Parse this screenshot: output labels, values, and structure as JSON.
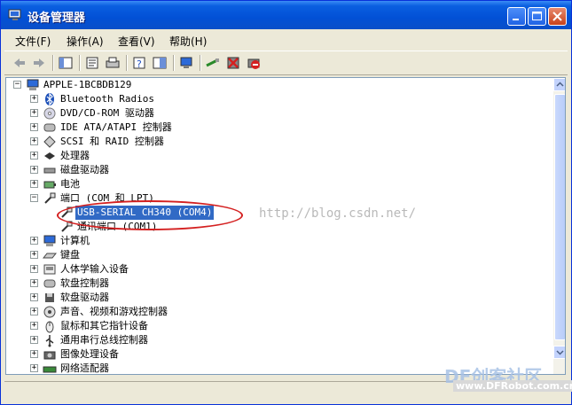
{
  "window": {
    "title": "设备管理器"
  },
  "menu": [
    {
      "label": "文件(F)"
    },
    {
      "label": "操作(A)"
    },
    {
      "label": "查看(V)"
    },
    {
      "label": "帮助(H)"
    }
  ],
  "tree": {
    "root": "APPLE-1BCBDB129",
    "items": [
      {
        "label": "Bluetooth Radios",
        "icon": "bluetooth-icon"
      },
      {
        "label": "DVD/CD-ROM 驱动器",
        "icon": "cdrom-icon"
      },
      {
        "label": "IDE ATA/ATAPI 控制器",
        "icon": "ide-controller-icon"
      },
      {
        "label": "SCSI 和 RAID 控制器",
        "icon": "scsi-icon"
      },
      {
        "label": "处理器",
        "icon": "cpu-icon"
      },
      {
        "label": "磁盘驱动器",
        "icon": "disk-icon"
      },
      {
        "label": "电池",
        "icon": "battery-icon"
      },
      {
        "label": "端口 (COM 和 LPT)",
        "icon": "port-icon",
        "expanded": true
      },
      {
        "label": "USB-SERIAL CH340 (COM4)",
        "icon": "port-icon",
        "child": true,
        "selected": true
      },
      {
        "label": "通讯端口 (COM1)",
        "icon": "port-icon",
        "child": true
      },
      {
        "label": "计算机",
        "icon": "computer-icon"
      },
      {
        "label": "键盘",
        "icon": "keyboard-icon"
      },
      {
        "label": "人体学输入设备",
        "icon": "hid-icon"
      },
      {
        "label": "软盘控制器",
        "icon": "floppy-controller-icon"
      },
      {
        "label": "软盘驱动器",
        "icon": "floppy-icon"
      },
      {
        "label": "声音、视频和游戏控制器",
        "icon": "sound-icon"
      },
      {
        "label": "鼠标和其它指针设备",
        "icon": "mouse-icon"
      },
      {
        "label": "通用串行总线控制器",
        "icon": "usb-icon"
      },
      {
        "label": "图像处理设备",
        "icon": "camera-icon"
      },
      {
        "label": "网络适配器",
        "icon": "network-icon"
      }
    ]
  },
  "watermark": "http://blog.csdn.net/",
  "brand": {
    "logo": "DF创客社区",
    "url": "www.DFRobot.com.cn"
  },
  "colors": {
    "title_bar": "#0250d6",
    "selection": "#316ac5",
    "highlight_ring": "#d42020"
  }
}
